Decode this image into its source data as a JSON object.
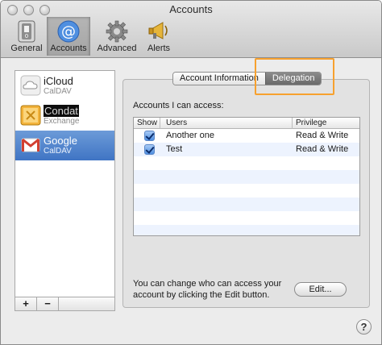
{
  "window": {
    "title": "Accounts"
  },
  "toolbar": {
    "items": [
      {
        "label": "General",
        "icon": "general-switch-icon"
      },
      {
        "label": "Accounts",
        "icon": "at-sign-icon",
        "active": true
      },
      {
        "label": "Advanced",
        "icon": "gear-icon"
      },
      {
        "label": "Alerts",
        "icon": "megaphone-icon"
      }
    ]
  },
  "accounts": {
    "items": [
      {
        "name": "iCloud",
        "type": "CalDAV",
        "icon": "icloud-icon"
      },
      {
        "name": "Condat",
        "type": "Exchange",
        "icon": "exchange-icon"
      },
      {
        "name": "Google",
        "type": "CalDAV",
        "icon": "gmail-icon",
        "selected": true
      }
    ],
    "add_label": "+",
    "remove_label": "−"
  },
  "tabs": {
    "account_information": "Account Information",
    "delegation": "Delegation",
    "active": "Delegation"
  },
  "delegation": {
    "section_label": "Accounts I can access:",
    "columns": [
      "Show",
      "Users",
      "Privilege"
    ],
    "rows": [
      {
        "show": true,
        "user": "Another one",
        "privilege": "Read & Write"
      },
      {
        "show": true,
        "user": "Test",
        "privilege": "Read & Write"
      }
    ],
    "hint": "You can change who can access your account by clicking the Edit button.",
    "edit_label": "Edit..."
  },
  "help_label": "?",
  "colors": {
    "highlight": "#f7a12f",
    "selection": "#3f74c4"
  }
}
